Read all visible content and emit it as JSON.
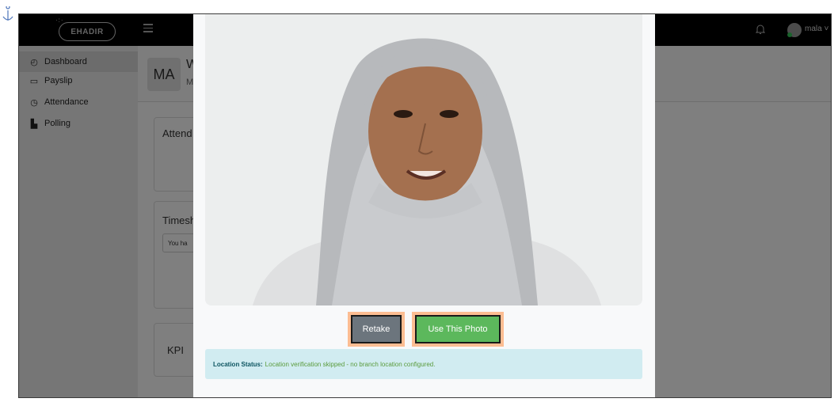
{
  "brand": {
    "logo_text": "EHADIR"
  },
  "sidebar": {
    "items": [
      {
        "label": "Dashboard",
        "icon": "gauge-icon"
      },
      {
        "label": "Payslip",
        "icon": "payslip-icon"
      },
      {
        "label": "Attendance",
        "icon": "clock-icon"
      },
      {
        "label": "Polling",
        "icon": "bar-chart-icon"
      }
    ]
  },
  "header": {
    "avatar_initials": "MA",
    "title_fragment": "W",
    "subtitle_fragment": "M"
  },
  "cards": {
    "attendance_title": "Attend",
    "timesheet_title": "Timesh",
    "timesheet_note": "You ha",
    "kpi_title": "KPI"
  },
  "topbar": {
    "user_name": "mala"
  },
  "modal": {
    "retake_label": "Retake",
    "use_photo_label": "Use This Photo",
    "location_label": "Location Status:",
    "location_message": "Location verification skipped - no branch location configured."
  },
  "colors": {
    "topbar": "#000000",
    "retake": "#6c757d",
    "use_photo": "#5cb85c",
    "status_bg": "#d1ecf1",
    "status_text": "#5a9b3c",
    "focus_glow": "#ff8c3c"
  }
}
